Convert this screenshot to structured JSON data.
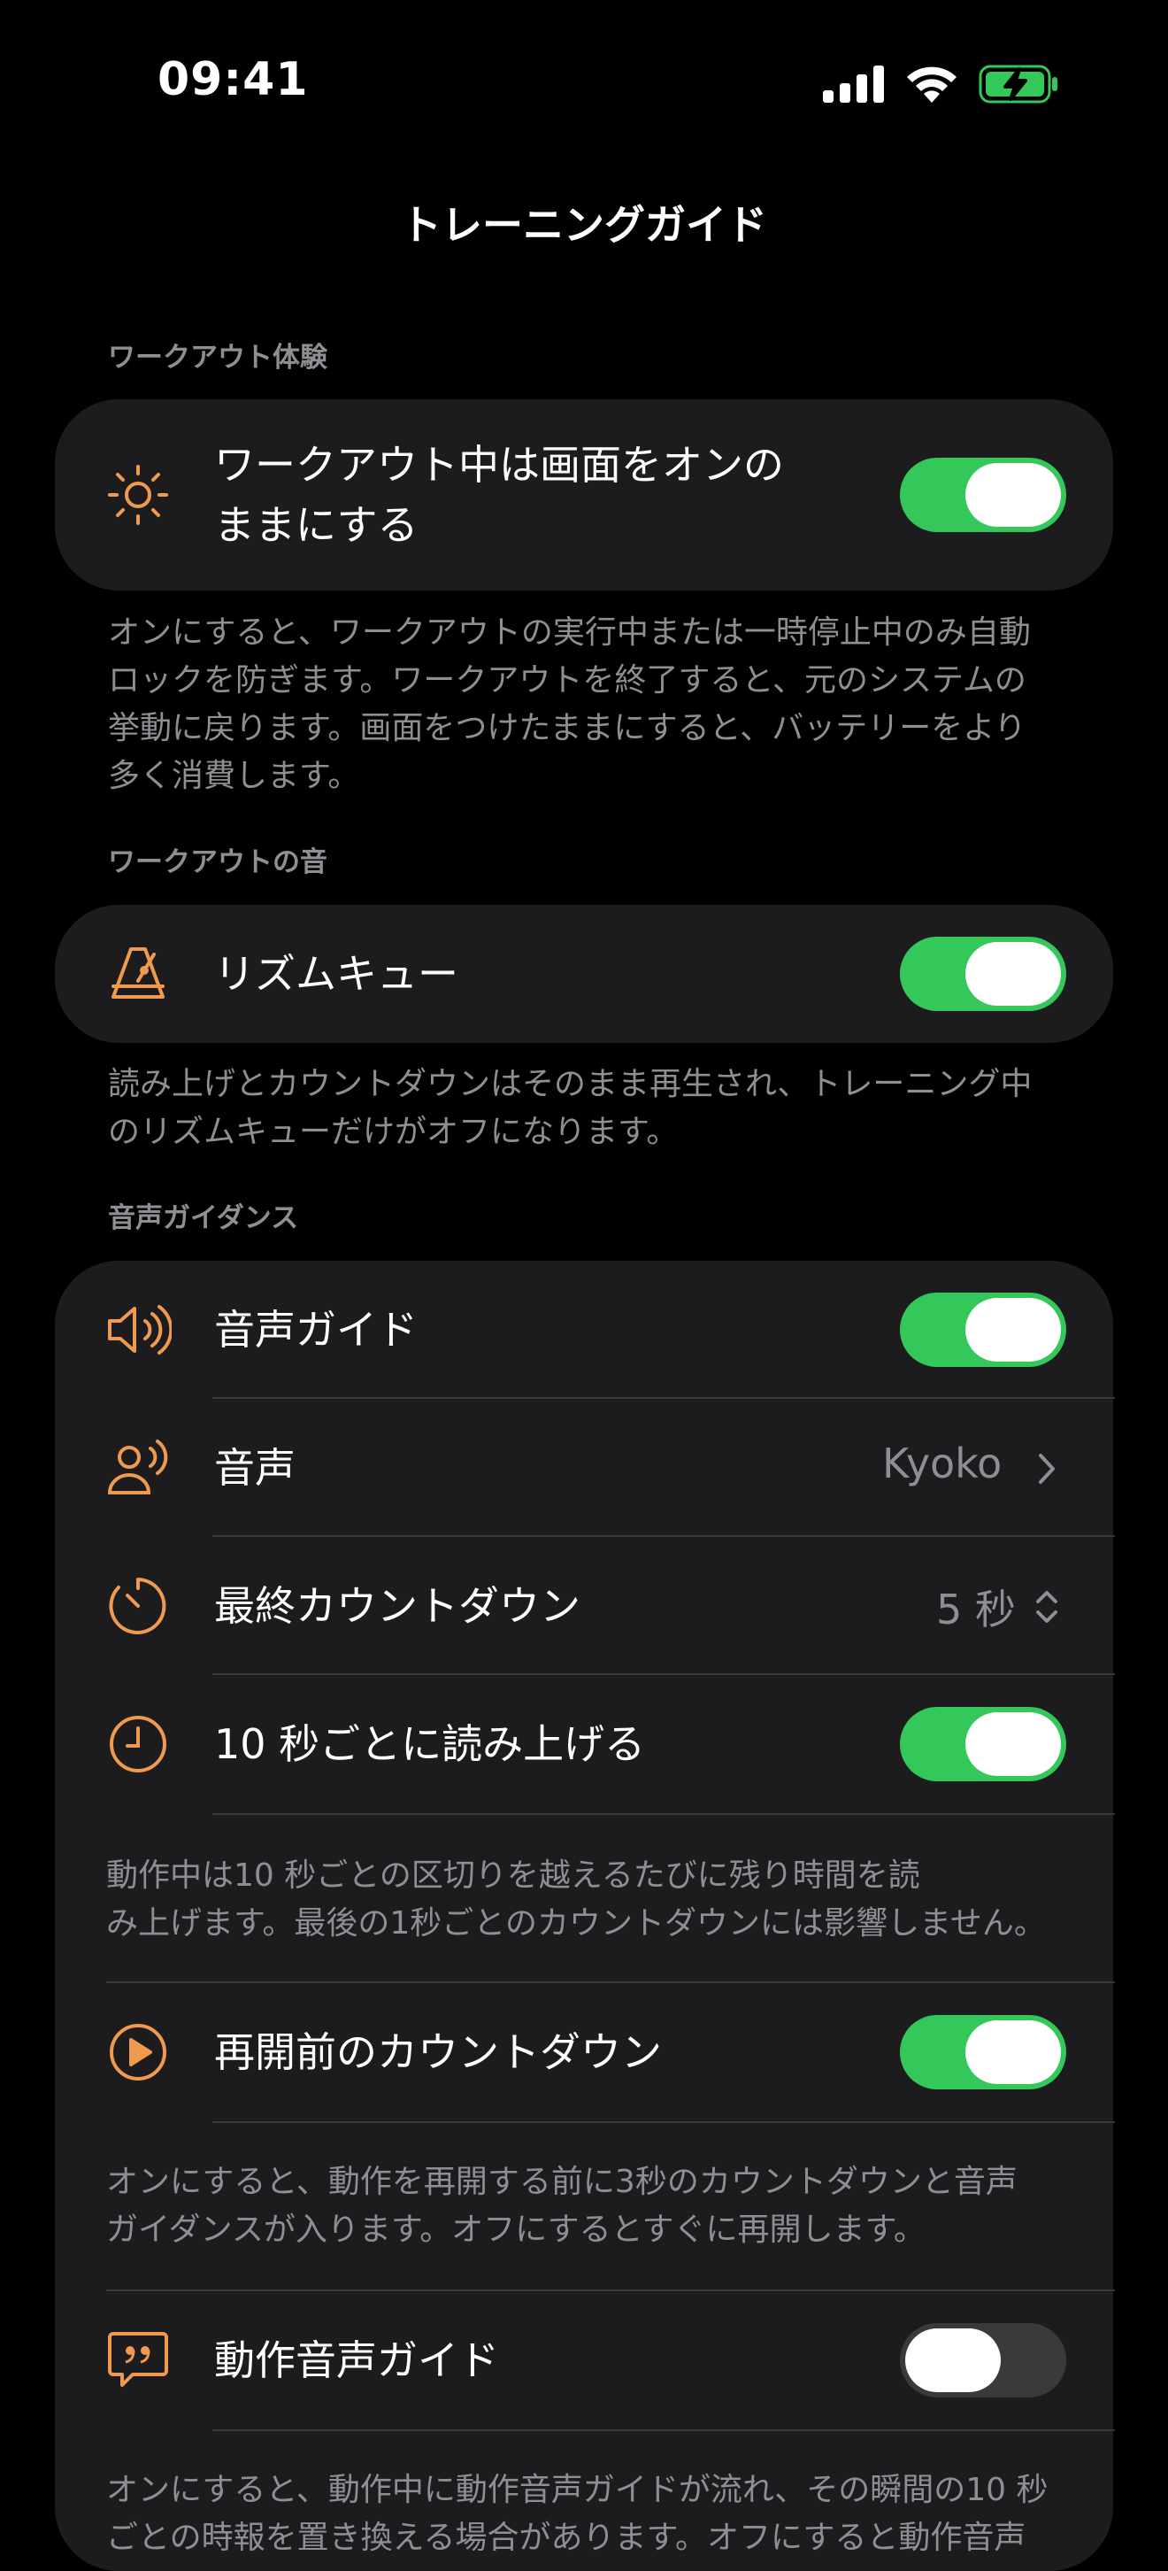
{
  "status_bar": {
    "time": "09:41",
    "icons": [
      "cellular-signal-icon",
      "wifi-icon",
      "battery-charging-icon"
    ],
    "battery_color": "#34c759"
  },
  "nav": {
    "title": "トレーニングガイド"
  },
  "colors": {
    "accent": "#f09a4f",
    "toggle_on": "#34c759",
    "toggle_off": "#3a3a3c",
    "card": "#1c1c1e",
    "secondary_text": "#8e8e93"
  },
  "sections": {
    "workout_experience": {
      "header": "ワークアウト体験",
      "row": {
        "icon": "sun-icon",
        "label_line1": "ワークアウト中は画面をオンの",
        "label_line2": "ままにする",
        "toggle": true
      },
      "footer_lines": [
        "オンにすると、ワークアウトの実行中または一時停止中のみ自動",
        "ロックを防ぎます。ワークアウトを終了すると、元のシステムの",
        "挙動に戻ります。画面をつけたままにすると、バッテリーをより",
        "多く消費します。"
      ]
    },
    "workout_sound": {
      "header": "ワークアウトの音",
      "row": {
        "icon": "metronome-icon",
        "label": "リズムキュー",
        "toggle": true
      },
      "footer_lines": [
        "読み上げとカウントダウンはそのまま再生され、トレーニング中",
        "のリズムキューだけがオフになります。"
      ]
    },
    "voice_guidance": {
      "header": "音声ガイダンス",
      "rows": {
        "voice_guide": {
          "icon": "speaker-icon",
          "label": "音声ガイド",
          "toggle": true
        },
        "voice": {
          "icon": "person-speaking-icon",
          "label": "音声",
          "value": "Kyoko"
        },
        "final_countdown": {
          "icon": "timer-icon",
          "label": "最終カウントダウン",
          "value": "5 秒"
        },
        "read_every_10": {
          "icon": "clock-icon",
          "label": "10 秒ごとに読み上げる",
          "toggle": true
        },
        "read_every_10_note": [
          "動作中は10 秒ごとの区切りを越えるたびに残り時間を読",
          "み上げます。最後の1秒ごとのカウントダウンには影響しません。"
        ],
        "resume_countdown": {
          "icon": "play-circle-icon",
          "label": "再開前のカウントダウン",
          "toggle": true
        },
        "resume_countdown_note": [
          "オンにすると、動作を再開する前に3秒のカウントダウンと音声",
          "ガイダンスが入ります。オフにするとすぐに再開します。"
        ],
        "motion_voice_guide": {
          "icon": "quote-bubble-icon",
          "label": "動作音声ガイド",
          "toggle": false
        },
        "motion_voice_guide_note": [
          "オンにすると、動作中に動作音声ガイドが流れ、その瞬間の10 秒",
          "ごとの時報を置き換える場合があります。オフにすると動作音声"
        ]
      }
    }
  }
}
